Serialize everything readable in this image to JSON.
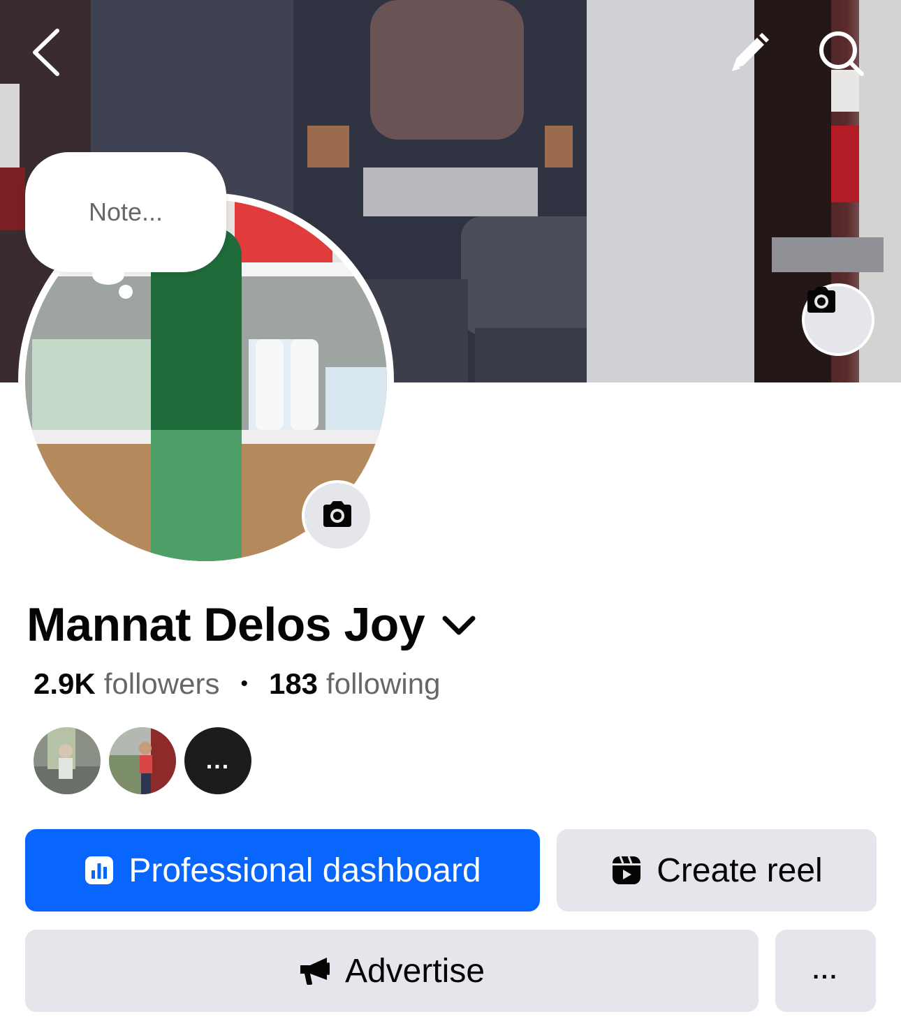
{
  "profile": {
    "name": "Mannat Delos Joy",
    "note_placeholder": "Note...",
    "followers_count": "2.9K",
    "followers_label": "followers",
    "separator": "•",
    "following_count": "183",
    "following_label": "following"
  },
  "friends": {
    "more_label": "..."
  },
  "actions": {
    "professional_dashboard": "Professional dashboard",
    "create_reel": "Create reel",
    "advertise": "Advertise",
    "more": "..."
  },
  "icons": {
    "back": "back-arrow-icon",
    "edit": "pencil-icon",
    "search": "search-icon",
    "camera": "camera-icon",
    "dashboard": "dashboard-icon",
    "reel": "reel-icon",
    "megaphone": "megaphone-icon"
  },
  "colors": {
    "primary": "#0866ff",
    "secondary_button": "#e4e6eb",
    "muted_text": "#65676b"
  }
}
